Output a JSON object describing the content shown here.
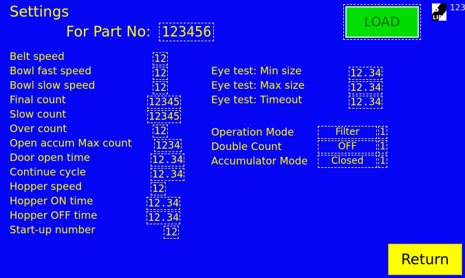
{
  "header": {
    "title": "Settings",
    "part_label": "For Part No:",
    "part_no": "123456"
  },
  "buttons": {
    "load": "LOAD",
    "return": "Return"
  },
  "logo": {
    "icon": "s-lib-logo",
    "text_top": "S",
    "text_bottom": "LIB",
    "corner_text": "123"
  },
  "left_params": [
    {
      "label": "Belt speed",
      "value": "12"
    },
    {
      "label": "Bowl fast speed",
      "value": "12"
    },
    {
      "label": "Bowl slow speed",
      "value": "12"
    },
    {
      "label": "Final count",
      "value": "12345"
    },
    {
      "label": "Slow count",
      "value": "12345"
    },
    {
      "label": "Over count",
      "value": "12"
    },
    {
      "label": "Open accum Max count",
      "value": "1234"
    },
    {
      "label": "Door open time",
      "value": "12.34"
    },
    {
      "label": "Continue cycle",
      "value": "12.34"
    },
    {
      "label": "Hopper speed",
      "value": "12"
    },
    {
      "label": "Hopper ON time",
      "value": "12.34"
    },
    {
      "label": "Hopper OFF time",
      "value": "12.34"
    },
    {
      "label": "Start-up number",
      "value": "12"
    }
  ],
  "eye_tests": [
    {
      "label": "Eye test: Min size",
      "value": "12.34"
    },
    {
      "label": "Eye test: Max size",
      "value": "12.34"
    },
    {
      "label": "Eye test: Timeout",
      "value": "12.34"
    }
  ],
  "modes": [
    {
      "label": "Operation Mode",
      "value": "Filter",
      "index": "1"
    },
    {
      "label": "Double Count",
      "value": "OFF",
      "index": "1"
    },
    {
      "label": "Accumulator Mode",
      "value": "Closed",
      "index": "1"
    }
  ],
  "colors": {
    "background": "#0505f5",
    "text": "#ffff00",
    "load_button": "#00dd00",
    "return_button": "#ffff00"
  }
}
